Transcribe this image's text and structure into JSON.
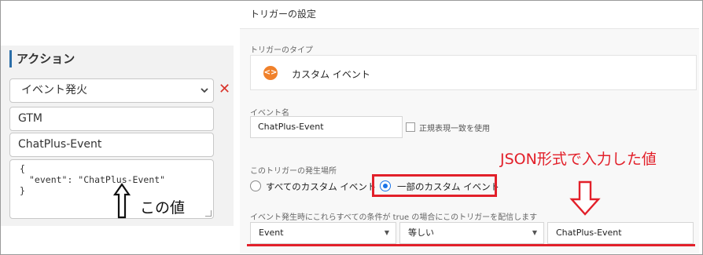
{
  "left_panel": {
    "title": "アクション",
    "action_select": "イベント発火",
    "delete_icon": "close-icon",
    "gtm_field": "GTM",
    "event_name_field": "ChatPlus-Event",
    "json_lines": [
      "{",
      "\"event\": \"ChatPlus-Event\"",
      "}"
    ],
    "annotation": "この値"
  },
  "right_panel": {
    "title": "トリガーの設定",
    "trigger_type_label": "トリガーのタイプ",
    "trigger_type_value": "カスタム イベント",
    "event_name_label": "イベント名",
    "event_name_value": "ChatPlus-Event",
    "regex_label": "正規表現一致を使用",
    "occurrence_label": "このトリガーの発生場所",
    "radio_all": "すべてのカスタム イベント",
    "radio_some": "一部のカスタム イベント",
    "selected_radio": "radio_some",
    "condition_label": "イベント発生時にこれらすべての条件が true の場合にこのトリガーを配信します",
    "condition_variable": "Event",
    "condition_operator": "等しい",
    "condition_value": "ChatPlus-Event",
    "annotation": "JSON形式で入力した値"
  },
  "colors": {
    "accent_blue": "#2b6ea8",
    "annotation_red": "#e2202a",
    "custom_event_orange": "#f0812b",
    "radio_blue": "#1a73e8"
  }
}
